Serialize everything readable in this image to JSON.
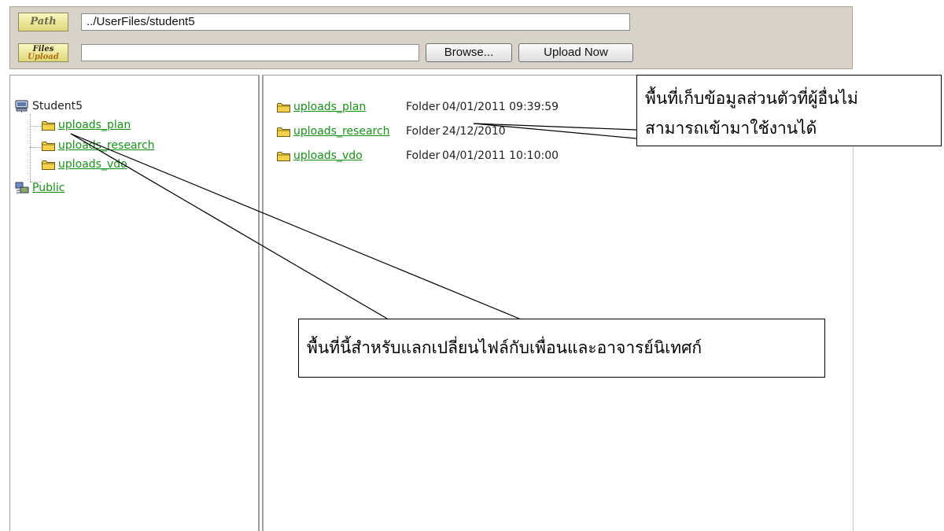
{
  "toolbar": {
    "path_tag": "Path",
    "files_tag_line1": "Files",
    "files_tag_line2": "Upload",
    "path_value": "../UserFiles/student5",
    "file_input_value": "",
    "browse_label": "Browse...",
    "upload_label": "Upload Now"
  },
  "tree": {
    "root_label": "Student5",
    "children": [
      "uploads_plan",
      "uploads_research",
      "uploads_vdo"
    ],
    "public_label": "Public"
  },
  "files": [
    {
      "name": "uploads_plan",
      "type": "Folder",
      "date": "04/01/2011 09:39:59"
    },
    {
      "name": "uploads_research",
      "type": "Folder",
      "date": "24/12/2010"
    },
    {
      "name": "uploads_vdo",
      "type": "Folder",
      "date": "04/01/2011 10:10:00"
    }
  ],
  "annotations": {
    "private_line1": "พื้นที่เก็บข้อมูลส่วนตัวที่ผู้อื่นไม่",
    "private_line2": "สามารถเข้ามาใช้งานได้",
    "shared": "พื้นที่นี้สำหรับแลกเปลี่ยนไฟล์กับเพื่อนและอาจารย์นิเทศก์"
  },
  "colors": {
    "link": "#199019",
    "folder": "#f2d24a",
    "toolbar_bg": "#d8d3c8"
  },
  "icons": {
    "server": "server-icon",
    "folder": "folder-icon",
    "network": "network-icon"
  }
}
